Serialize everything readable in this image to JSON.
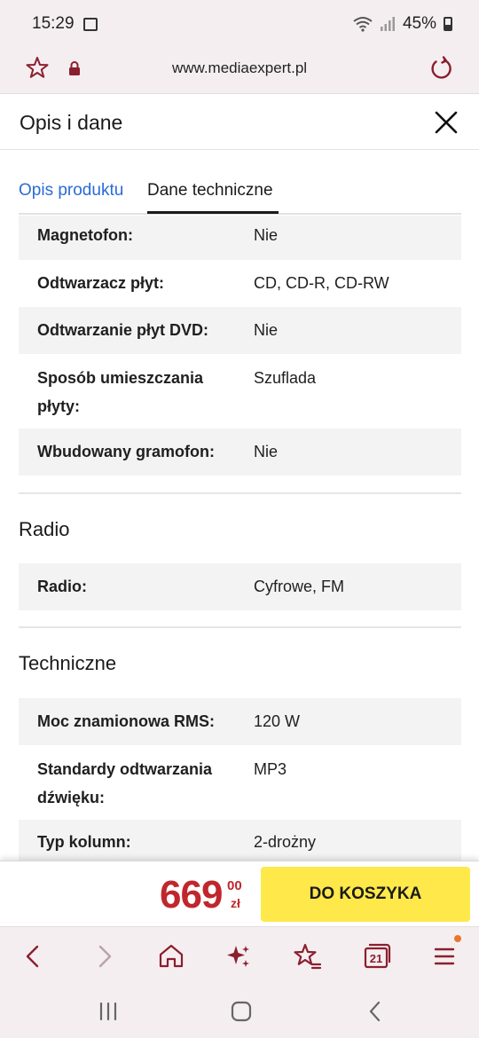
{
  "status_bar": {
    "time": "15:29",
    "battery": "45%"
  },
  "browser": {
    "url": "www.mediaexpert.pl"
  },
  "sheet": {
    "title": "Opis i dane",
    "tabs": [
      {
        "label": "Opis produktu"
      },
      {
        "label": "Dane techniczne"
      }
    ]
  },
  "specs": {
    "top_rows": [
      {
        "label": "Magnetofon:",
        "value": "Nie"
      },
      {
        "label": "Odtwarzacz płyt:",
        "value": "CD, CD-R, CD-RW"
      },
      {
        "label": "Odtwarzanie płyt DVD:",
        "value": "Nie"
      },
      {
        "label": "Sposób umieszczania płyty:",
        "value": "Szuflada"
      },
      {
        "label": "Wbudowany gramofon:",
        "value": "Nie"
      }
    ],
    "sections": [
      {
        "title": "Radio",
        "rows": [
          {
            "label": "Radio:",
            "value": "Cyfrowe, FM"
          }
        ]
      },
      {
        "title": "Techniczne",
        "rows": [
          {
            "label": "Moc znamionowa RMS:",
            "value": "120 W"
          },
          {
            "label": "Standardy odtwarzania dźwięku:",
            "value": "MP3"
          },
          {
            "label": "Typ kolumn:",
            "value": "2-drożny"
          }
        ]
      }
    ]
  },
  "buy_bar": {
    "price_integer": "669",
    "price_cents": "00",
    "currency": "zł",
    "cart_button": "DO KOSZYKA"
  },
  "browser_nav": {
    "tabs_count": "21"
  },
  "colors": {
    "brand_red": "#c0272d",
    "accent_yellow": "#ffe84a",
    "link_blue": "#2b6bd6",
    "browser_icon": "#8a1f2e"
  }
}
